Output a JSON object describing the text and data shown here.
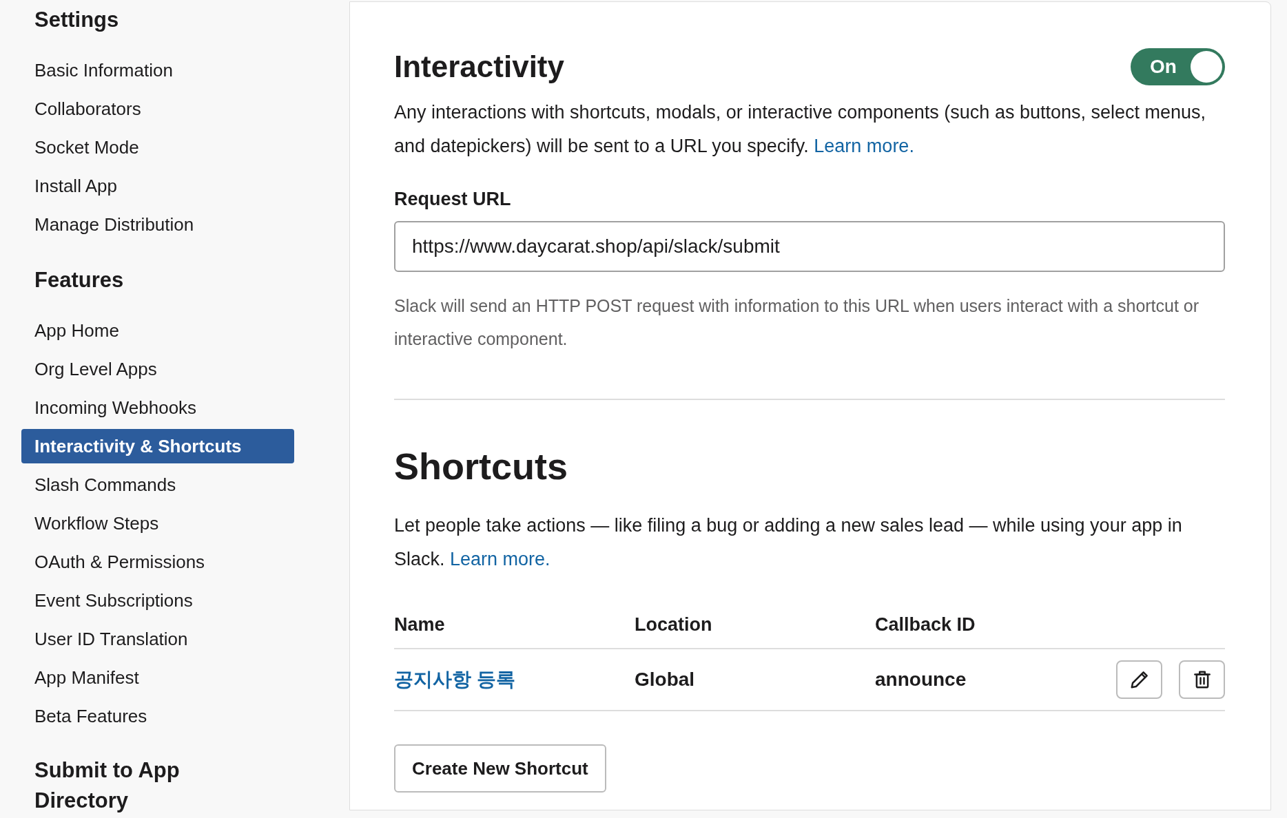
{
  "sidebar": {
    "sections": [
      {
        "heading": "Settings",
        "items": [
          {
            "label": "Basic Information",
            "selected": false
          },
          {
            "label": "Collaborators",
            "selected": false
          },
          {
            "label": "Socket Mode",
            "selected": false
          },
          {
            "label": "Install App",
            "selected": false
          },
          {
            "label": "Manage Distribution",
            "selected": false
          }
        ]
      },
      {
        "heading": "Features",
        "items": [
          {
            "label": "App Home",
            "selected": false
          },
          {
            "label": "Org Level Apps",
            "selected": false
          },
          {
            "label": "Incoming Webhooks",
            "selected": false
          },
          {
            "label": "Interactivity & Shortcuts",
            "selected": true
          },
          {
            "label": "Slash Commands",
            "selected": false
          },
          {
            "label": "Workflow Steps",
            "selected": false
          },
          {
            "label": "OAuth & Permissions",
            "selected": false
          },
          {
            "label": "Event Subscriptions",
            "selected": false
          },
          {
            "label": "User ID Translation",
            "selected": false
          },
          {
            "label": "App Manifest",
            "selected": false
          },
          {
            "label": "Beta Features",
            "selected": false
          }
        ]
      },
      {
        "heading": "Submit to App Directory"
      }
    ]
  },
  "interactivity": {
    "title": "Interactivity",
    "toggle": {
      "label": "On",
      "on": true
    },
    "description": "Any interactions with shortcuts, modals, or interactive components (such as buttons, select menus, and datepickers) will be sent to a URL you specify.",
    "link": "Learn more.",
    "request_url": {
      "label": "Request URL",
      "value": "https://www.daycarat.shop/api/slack/submit"
    },
    "help": "Slack will send an HTTP POST request with information to this URL when users interact with a shortcut or interactive component."
  },
  "shortcuts": {
    "title": "Shortcuts",
    "description": "Let people take actions — like filing a bug or adding a new sales lead — while using your app in Slack.",
    "link": "Learn more.",
    "table": {
      "columns": [
        "Name",
        "Location",
        "Callback ID"
      ],
      "rows": [
        {
          "name": "공지사항 등록",
          "location": "Global",
          "callback_id": "announce"
        }
      ]
    },
    "create_button": "Create New Shortcut"
  }
}
